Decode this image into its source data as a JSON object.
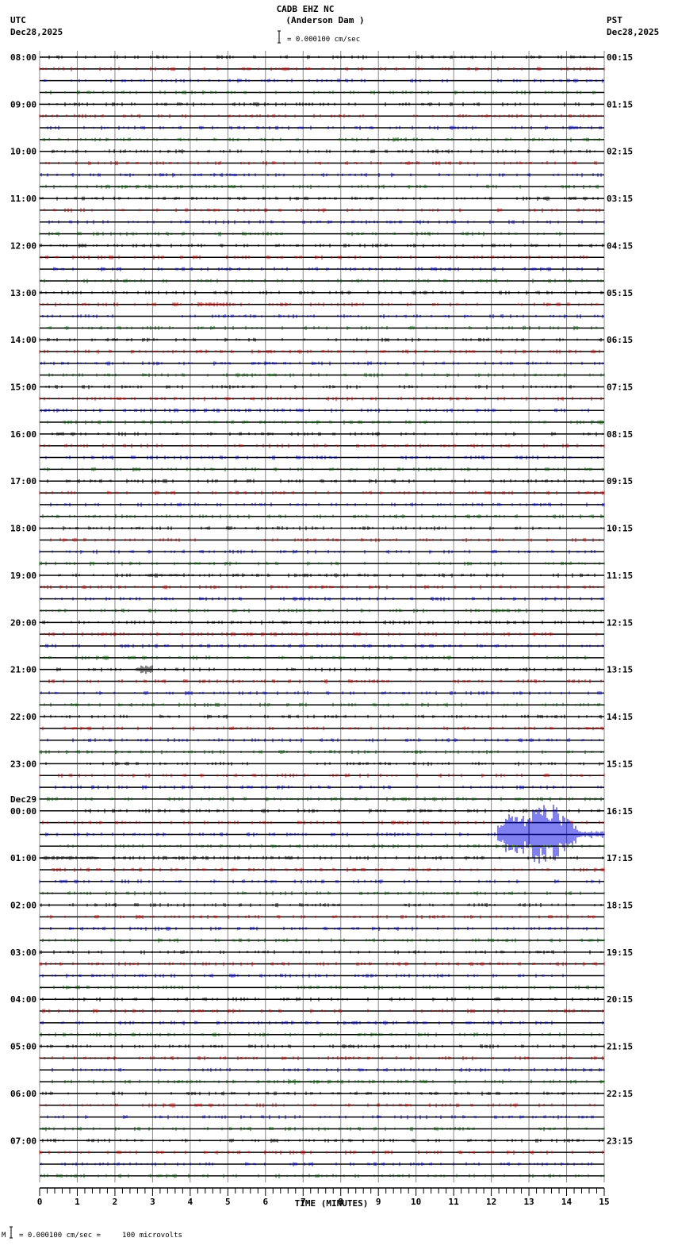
{
  "header": {
    "title": "CADB EHZ NC",
    "subtitle": "(Anderson Dam )",
    "scale_text": "= 0.000100 cm/sec",
    "left_tz": "UTC",
    "left_date": "Dec28,2025",
    "right_tz": "PST",
    "right_date": "Dec28,2025"
  },
  "footer": {
    "scale_note": "= 0.000100 cm/sec =     100 microvolts"
  },
  "chart_data": {
    "type": "line",
    "title": "CADB EHZ NC (Anderson Dam )",
    "xlabel": "TIME (MINUTES)",
    "xlim": [
      0,
      15
    ],
    "x_ticks": [
      "0",
      "1",
      "2",
      "3",
      "4",
      "5",
      "6",
      "7",
      "8",
      "9",
      "10",
      "11",
      "12",
      "13",
      "14",
      "15"
    ],
    "traces_per_hour": 4,
    "trace_count": 96,
    "trace_colors": [
      "#000000",
      "#d00000",
      "#0000e0",
      "#006000"
    ],
    "day_change_label": "Dec29",
    "day_change_hour_index": 16,
    "utc_labels": [
      "08:00",
      "09:00",
      "10:00",
      "11:00",
      "12:00",
      "13:00",
      "14:00",
      "15:00",
      "16:00",
      "17:00",
      "18:00",
      "19:00",
      "20:00",
      "21:00",
      "22:00",
      "23:00",
      "00:00",
      "01:00",
      "02:00",
      "03:00",
      "04:00",
      "05:00",
      "06:00",
      "07:00"
    ],
    "pst_labels": [
      "00:15",
      "01:15",
      "02:15",
      "03:15",
      "04:15",
      "05:15",
      "06:15",
      "07:15",
      "08:15",
      "09:15",
      "10:15",
      "11:15",
      "12:15",
      "13:15",
      "14:15",
      "15:15",
      "16:15",
      "17:15",
      "18:15",
      "19:15",
      "20:15",
      "21:15",
      "22:15",
      "23:15"
    ],
    "events": [
      {
        "trace": 21,
        "start_min": 4.2,
        "end_min": 5.0,
        "amplitude": 0.2
      },
      {
        "trace": 25,
        "start_min": 11.3,
        "end_min": 11.6,
        "amplitude": 0.12
      },
      {
        "trace": 27,
        "start_min": 6.0,
        "end_min": 6.3,
        "amplitude": 0.15
      },
      {
        "trace": 29,
        "start_min": 1.9,
        "end_min": 2.3,
        "amplitude": 0.12
      },
      {
        "trace": 31,
        "start_min": 7.0,
        "end_min": 7.5,
        "amplitude": 0.1
      },
      {
        "trace": 44,
        "start_min": 2.8,
        "end_min": 3.8,
        "amplitude": 0.12
      },
      {
        "trace": 47,
        "start_min": 12.0,
        "end_min": 12.5,
        "amplitude": 0.15
      },
      {
        "trace": 52,
        "start_min": 2.6,
        "end_min": 3.0,
        "amplitude": 0.35
      },
      {
        "trace": 66,
        "start_min": 12.15,
        "end_min": 15.0,
        "amplitude": 3.0,
        "peak_min": 13.5
      },
      {
        "trace": 68,
        "start_min": 0.0,
        "end_min": 1.6,
        "amplitude": 0.15
      },
      {
        "trace": 87,
        "start_min": 6.6,
        "end_min": 6.9,
        "amplitude": 0.25
      }
    ]
  }
}
